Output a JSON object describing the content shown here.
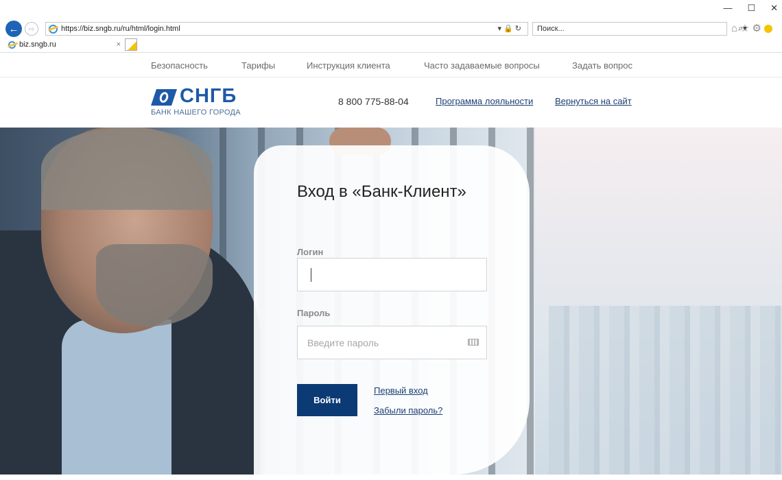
{
  "browser": {
    "url": "https://biz.sngb.ru/ru/html/login.html",
    "search_placeholder": "Поиск...",
    "tab_title": "biz.sngb.ru",
    "tab_close": "×"
  },
  "site_nav": {
    "items": [
      {
        "label": "Безопасность"
      },
      {
        "label": "Тарифы"
      },
      {
        "label": "Инструкция клиента"
      },
      {
        "label": "Часто задаваемые вопросы"
      },
      {
        "label": "Задать вопрос"
      }
    ]
  },
  "header": {
    "logo_text": "СНГБ",
    "logo_tagline": "БАНК НАШЕГО ГОРОДА",
    "phone": "8 800 775-88-04",
    "loyalty_link": "Программа лояльности",
    "back_link": "Вернуться на сайт"
  },
  "login": {
    "title": "Вход в «Банк-Клиент»",
    "login_label": "Логин",
    "login_value": "",
    "password_label": "Пароль",
    "password_placeholder": "Введите пароль",
    "submit_label": "Войти",
    "first_login_link": "Первый вход",
    "forgot_link": "Забыли пароль?"
  },
  "colors": {
    "brand_blue": "#1e59a8",
    "button_navy": "#0b3a75",
    "link_color": "#1c3f73"
  }
}
